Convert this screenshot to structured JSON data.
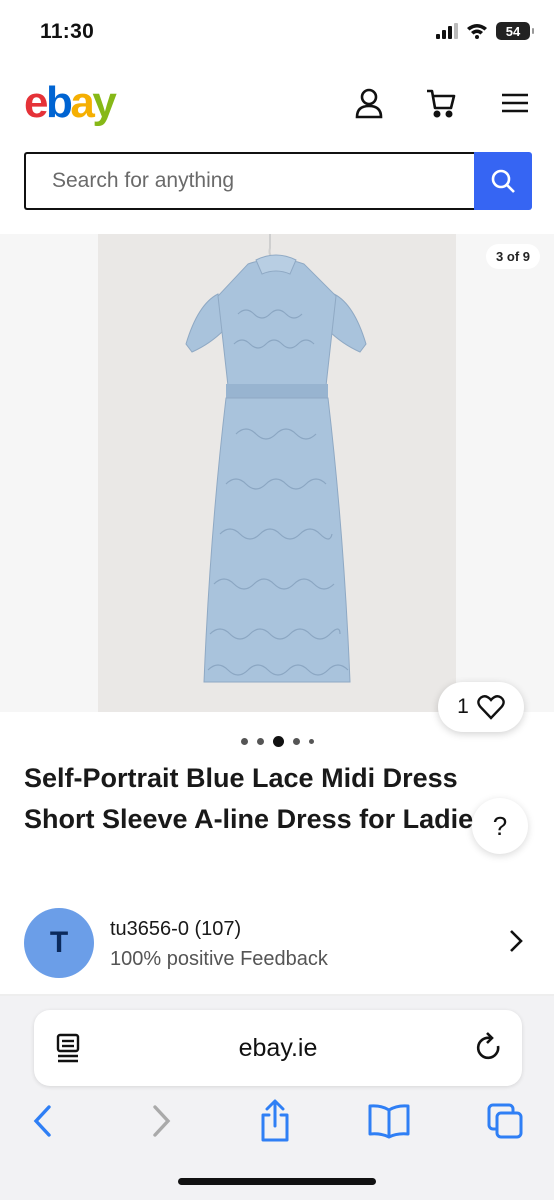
{
  "status_bar": {
    "time": "11:30",
    "battery": "54"
  },
  "header": {
    "logo_letters": [
      "e",
      "b",
      "a",
      "y"
    ],
    "icons": [
      "account-icon",
      "cart-icon",
      "menu-icon"
    ]
  },
  "search": {
    "placeholder": "Search for anything",
    "button_icon": "search-icon"
  },
  "gallery": {
    "counter": "3 of 9",
    "watch_count": "1",
    "current_index": 3,
    "dots_visible": 5
  },
  "listing": {
    "title": "Self-Portrait Blue Lace Midi Dress Short Sleeve A-line Dress for Ladies",
    "help_label": "?"
  },
  "seller": {
    "avatar_initial": "T",
    "name": "tu3656-0 (107)",
    "feedback": "100% positive Feedback"
  },
  "browser": {
    "url": "ebay.ie"
  },
  "colors": {
    "search_button": "#3665f3",
    "avatar": "#6b9ee8",
    "safari_blue": "#2f7ff5",
    "dress": "#a9c3dc"
  }
}
